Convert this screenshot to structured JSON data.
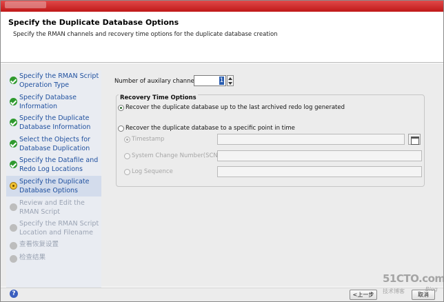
{
  "header": {
    "title": "Specify the Duplicate Database Options",
    "subtitle": "Specify the RMAN channels and recovery time options for the duplicate database creation"
  },
  "steps": [
    {
      "label": "Specify the RMAN Script Operation Type",
      "status": "done"
    },
    {
      "label": "Specify Database Information",
      "status": "done"
    },
    {
      "label": "Specify the Duplicate Database Information",
      "status": "done"
    },
    {
      "label": "Select the Objects for Database Duplication",
      "status": "done"
    },
    {
      "label": "Specify the Datafile and Redo Log Locations",
      "status": "done"
    },
    {
      "label": "Specify the Duplicate Database Options",
      "status": "current"
    },
    {
      "label": "Review and Edit the RMAN Script",
      "status": "pending"
    },
    {
      "label": "Specify the RMAN Script Location and Filename",
      "status": "pending"
    },
    {
      "label": "查看恢复设置",
      "status": "pending"
    },
    {
      "label": "检查结果",
      "status": "pending"
    }
  ],
  "form": {
    "channels_label": "Number of auxilary channels:",
    "channels_value": "1",
    "recovery_legend": "Recovery Time Options",
    "option_last_archived": "Recover the duplicate database up to the last archived redo log generated",
    "option_point_in_time": "Recover the duplicate database to a specific point in time",
    "timestamp_label": "Timestamp",
    "scn_label": "System Change Number(SCN)",
    "log_sequence_label": "Log Sequence",
    "timestamp_value": "",
    "scn_value": "",
    "log_sequence_value": ""
  },
  "buttons": {
    "back": "<上一步",
    "cancel": "取消"
  },
  "help": "?",
  "watermark": {
    "line1": "51CTO.com",
    "line2": "技术博客",
    "line3": "Blog"
  },
  "colors": {
    "titlebar": "#c81f1f",
    "step_link": "#1e4f9e",
    "step_done": "#2f9a2f",
    "step_current": "#f1c232"
  }
}
